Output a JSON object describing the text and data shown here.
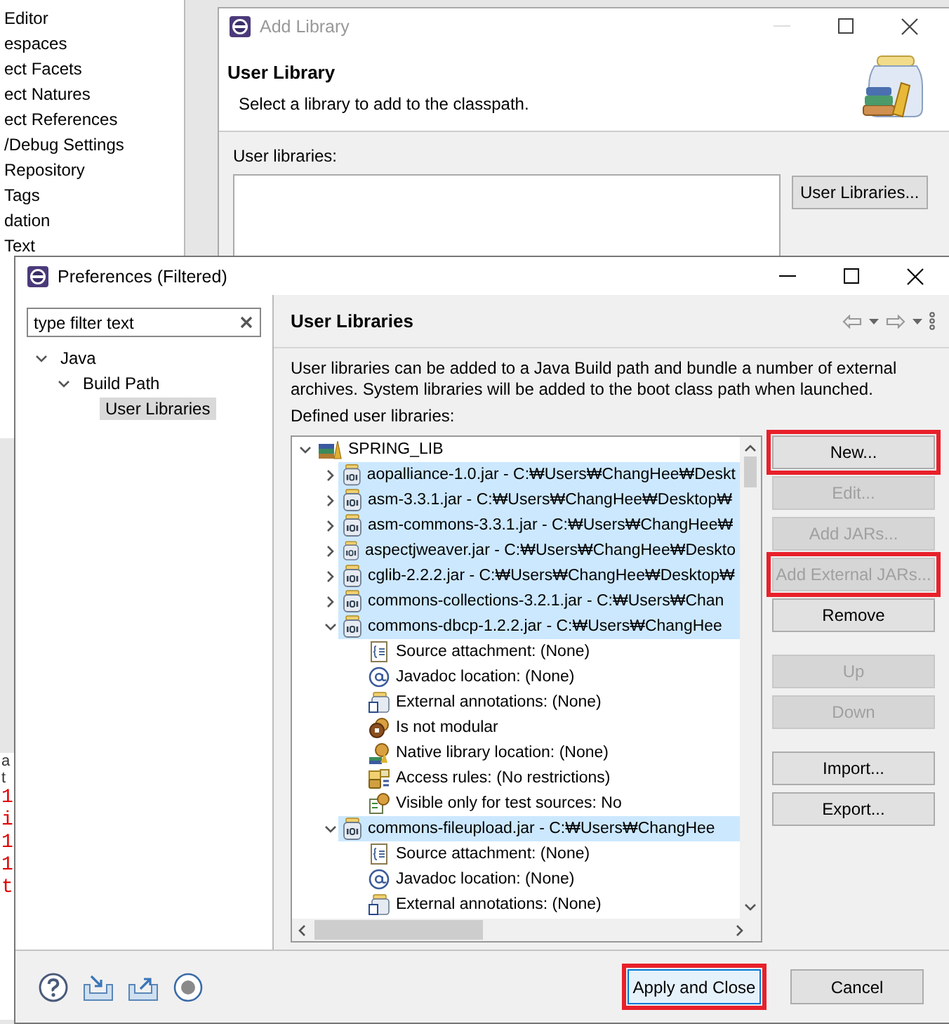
{
  "background_window": {
    "items": [
      "Editor",
      "espaces",
      "ect Facets",
      "ect Natures",
      "ect References",
      "/Debug Settings",
      "Repository",
      "Tags",
      "dation",
      "Text"
    ]
  },
  "background_editor": {
    "lines": [
      {
        "text": "a",
        "kind": "plain"
      },
      {
        "text": "t",
        "kind": "plain"
      },
      {
        "text": "1",
        "kind": "literal"
      },
      {
        "text": "i",
        "kind": "literal"
      },
      {
        "text": "1",
        "kind": "literal"
      },
      {
        "text": "1",
        "kind": "literal"
      },
      {
        "text": "t",
        "kind": "literal"
      }
    ]
  },
  "add_library": {
    "title": "Add Library",
    "heading": "User Library",
    "description": "Select a library to add to the classpath.",
    "list_label": "User libraries:",
    "button": "User Libraries..."
  },
  "preferences": {
    "title": "Preferences (Filtered)",
    "filter": {
      "placeholder": "type filter text"
    },
    "nav_tree": [
      {
        "label": "Java",
        "expanded": true,
        "selected": false,
        "children": [
          {
            "label": "Build Path",
            "expanded": true,
            "selected": false,
            "children": [
              {
                "label": "User Libraries",
                "selected": true
              }
            ]
          }
        ]
      }
    ],
    "page": {
      "title": "User Libraries",
      "description": "User libraries can be added to a Java Build path and bundle a number of external archives. System libraries will be added to the boot class path when launched.",
      "list_label": "Defined user libraries:",
      "tree": [
        {
          "label": "SPRING_LIB",
          "kind": "library",
          "expanded": true,
          "selected": false,
          "children": [
            {
              "label": "aopalliance-1.0.jar - C:₩Users₩ChangHee₩Deskt",
              "kind": "jar",
              "expanded": false,
              "selected": true
            },
            {
              "label": "asm-3.3.1.jar - C:₩Users₩ChangHee₩Desktop₩",
              "kind": "jar",
              "expanded": false,
              "selected": true
            },
            {
              "label": "asm-commons-3.3.1.jar - C:₩Users₩ChangHee₩",
              "kind": "jar",
              "expanded": false,
              "selected": true
            },
            {
              "label": "aspectjweaver.jar - C:₩Users₩ChangHee₩Deskto",
              "kind": "jar",
              "expanded": false,
              "selected": true
            },
            {
              "label": "cglib-2.2.2.jar - C:₩Users₩ChangHee₩Desktop₩",
              "kind": "jar",
              "expanded": false,
              "selected": true
            },
            {
              "label": "commons-collections-3.2.1.jar - C:₩Users₩Chan",
              "kind": "jar",
              "expanded": false,
              "selected": true
            },
            {
              "label": "commons-dbcp-1.2.2.jar - C:₩Users₩ChangHee",
              "kind": "jar",
              "expanded": true,
              "selected": true,
              "children": [
                {
                  "label": "Source attachment: (None)",
                  "kind": "source",
                  "selected": false
                },
                {
                  "label": "Javadoc location: (None)",
                  "kind": "javadoc",
                  "selected": false
                },
                {
                  "label": "External annotations: (None)",
                  "kind": "annotations",
                  "selected": false
                },
                {
                  "label": "Is not modular",
                  "kind": "module",
                  "selected": false
                },
                {
                  "label": "Native library location: (None)",
                  "kind": "native",
                  "selected": false
                },
                {
                  "label": "Access rules: (No restrictions)",
                  "kind": "access",
                  "selected": false
                },
                {
                  "label": "Visible only for test sources: No",
                  "kind": "visible",
                  "selected": false
                }
              ]
            },
            {
              "label": "commons-fileupload.jar - C:₩Users₩ChangHee",
              "kind": "jar",
              "expanded": true,
              "selected": true,
              "children": [
                {
                  "label": "Source attachment: (None)",
                  "kind": "source",
                  "selected": false
                },
                {
                  "label": "Javadoc location: (None)",
                  "kind": "javadoc",
                  "selected": false
                },
                {
                  "label": "External annotations: (None)",
                  "kind": "annotations",
                  "selected": false
                }
              ]
            }
          ]
        }
      ],
      "button_groups": [
        [
          {
            "label": "New...",
            "disabled": false,
            "highlighted": true
          },
          {
            "label": "Edit...",
            "disabled": true,
            "highlighted": false
          },
          {
            "label": "Add JARs...",
            "disabled": true,
            "highlighted": false
          },
          {
            "label": "Add External JARs...",
            "disabled": true,
            "highlighted": true
          },
          {
            "label": "Remove",
            "disabled": false,
            "highlighted": false
          }
        ],
        [
          {
            "label": "Up",
            "disabled": true,
            "highlighted": false
          },
          {
            "label": "Down",
            "disabled": true,
            "highlighted": false
          }
        ],
        [
          {
            "label": "Import...",
            "disabled": false,
            "highlighted": false
          },
          {
            "label": "Export...",
            "disabled": false,
            "highlighted": false
          }
        ]
      ]
    },
    "footer": {
      "buttons": [
        {
          "label": "Apply and Close",
          "default": true,
          "highlighted": true
        },
        {
          "label": "Cancel",
          "default": false,
          "highlighted": false
        }
      ]
    }
  }
}
